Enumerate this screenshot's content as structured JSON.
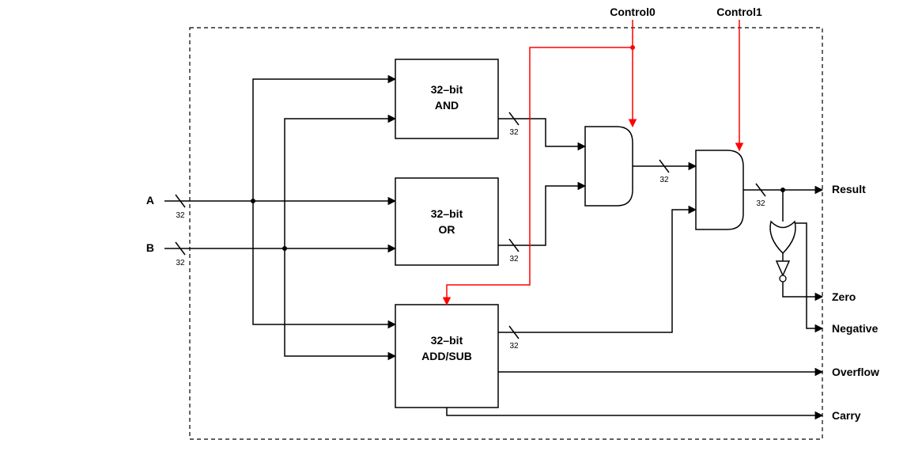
{
  "inputs": {
    "a": "A",
    "b": "B"
  },
  "controls": {
    "c0": "Control0",
    "c1": "Control1"
  },
  "outputs": {
    "result": "Result",
    "zero": "Zero",
    "negative": "Negative",
    "overflow": "Overflow",
    "carry": "Carry"
  },
  "blocks": {
    "and_l1": "32–bit",
    "and_l2": "AND",
    "or_l1": "32–bit",
    "or_l2": "OR",
    "add_l1": "32–bit",
    "add_l2": "ADD/SUB"
  },
  "bus_width": "32"
}
